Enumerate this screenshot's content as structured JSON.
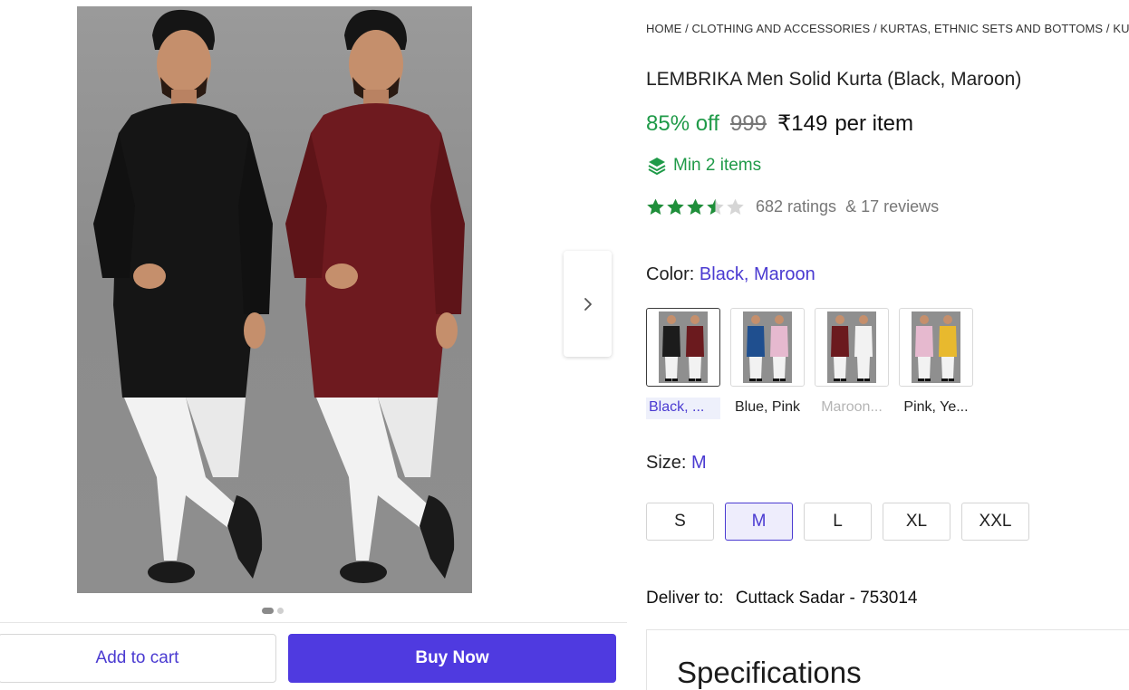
{
  "gallery": {
    "image_alt": "Two men wearing black and maroon kurtas with white pants",
    "current_slide": 1,
    "total_slides": 2,
    "next_icon": "chevron-right-icon"
  },
  "actions": {
    "add_to_cart_label": "Add to cart",
    "buy_now_label": "Buy Now"
  },
  "breadcrumb": {
    "text": "HOME / CLOTHING AND ACCESSORIES / KURTAS, ETHNIC SETS AND BOTTOMS / KURTAS"
  },
  "product": {
    "title": "LEMBRIKA Men Solid Kurta (Black, Maroon)",
    "discount": "85% off",
    "mrp": "999",
    "price": "₹149",
    "price_unit": "per item",
    "min_items_icon": "stacked-layers-icon",
    "min_items": "Min 2 items",
    "rating_value": 3.5,
    "ratings_text": "682 ratings",
    "reviews_text": "& 17 reviews"
  },
  "color": {
    "label": "Color:",
    "selected": "Black, Maroon",
    "variants": [
      {
        "label": "Black, ...",
        "left": "#1c1c1c",
        "right": "#6b1a1e",
        "selected": true,
        "disabled": false
      },
      {
        "label": "Blue, Pink",
        "left": "#1f4f8f",
        "right": "#e6b9cf",
        "selected": false,
        "disabled": false
      },
      {
        "label": "Maroon...",
        "left": "#6b1a1e",
        "right": "#f2f2f2",
        "selected": false,
        "disabled": true
      },
      {
        "label": "Pink, Ye...",
        "left": "#e6b9cf",
        "right": "#e8b92e",
        "selected": false,
        "disabled": false
      }
    ]
  },
  "size": {
    "label": "Size:",
    "selected": "M",
    "options": [
      "S",
      "M",
      "L",
      "XL",
      "XXL"
    ]
  },
  "delivery": {
    "label": "Deliver to:",
    "location": "Cuttack Sadar - 753014"
  },
  "specifications": {
    "title": "Specifications"
  },
  "colors": {
    "accent": "#4f3ae0",
    "discount_green": "#1f9a48",
    "star_green": "#1f8f3a",
    "kurta_black": "#151515",
    "kurta_maroon": "#6e1a1f"
  }
}
